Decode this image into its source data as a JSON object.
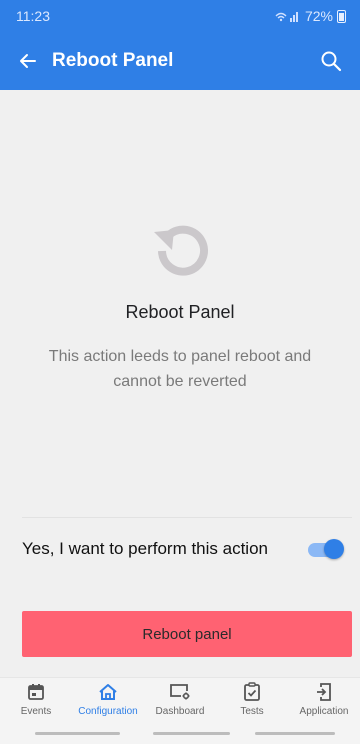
{
  "status_bar": {
    "time": "11:23",
    "battery": "72%"
  },
  "app_bar": {
    "title": "Reboot Panel",
    "back_icon": "arrow-left-icon",
    "search_icon": "search-icon"
  },
  "main": {
    "icon": "refresh-icon",
    "title": "Reboot Panel",
    "description": "This action leeds to panel reboot and cannot be reverted",
    "confirm_label": "Yes, I want to perform this action",
    "confirm_toggle_on": true,
    "button_label": "Reboot panel"
  },
  "colors": {
    "primary": "#2f7fe6",
    "danger": "#ff6272",
    "background": "#f0f0f0"
  },
  "bottom_nav": {
    "active": "Configuration",
    "items": [
      {
        "label": "Events",
        "icon": "calendar-icon"
      },
      {
        "label": "Configuration",
        "icon": "home-icon"
      },
      {
        "label": "Dashboard",
        "icon": "monitor-gear-icon"
      },
      {
        "label": "Tests",
        "icon": "clipboard-check-icon"
      },
      {
        "label": "Application",
        "icon": "phone-login-icon"
      }
    ]
  }
}
